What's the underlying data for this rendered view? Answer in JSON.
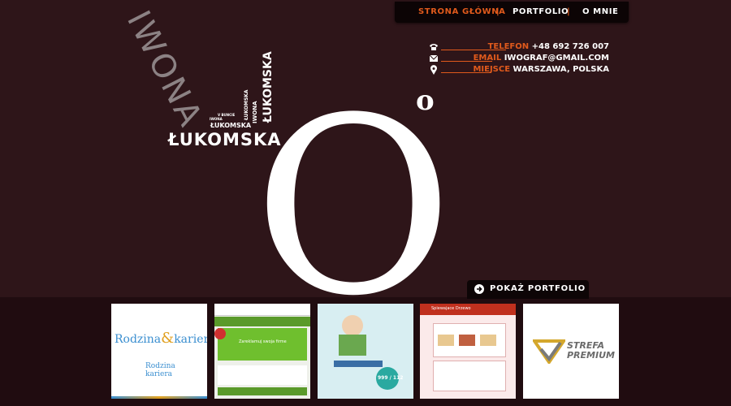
{
  "nav": {
    "items": [
      {
        "label": "STRONA GŁÓWNA",
        "active": true
      },
      {
        "label": "PORTFOLIO",
        "active": false
      },
      {
        "label": "O MNIE",
        "active": false
      }
    ],
    "separator": "|"
  },
  "contact": {
    "phone": {
      "key": "TELEFON",
      "value": "+48 692 726 007",
      "icon": "phone-icon"
    },
    "email": {
      "key": "EMAIL",
      "value": "IWOGRAF@GMAIL.COM",
      "icon": "envelope-icon"
    },
    "place": {
      "key": "MIEJSCE",
      "value": "WARSZAWA, POLSKA",
      "icon": "location-pin-icon"
    }
  },
  "logo": {
    "big_letter": "O",
    "degree": "o",
    "name_large": "ŁUKOMSKA",
    "name_diag": "IWONA",
    "name_vert": "ŁUKOMSKA",
    "small_words": [
      "ŁUKOMSKA",
      "IWONA",
      "ŁUKOMSKA",
      "IWONA",
      "V BUNCIE"
    ]
  },
  "cta": {
    "label": "POKAŻ PORTFOLIO",
    "icon": "arrow-right-icon"
  },
  "thumbs": [
    {
      "title": "Rodzina",
      "amp": "&",
      "title2": "kariera",
      "sub1": "Rodzina",
      "sub2": "kariera"
    },
    {
      "title": "Zareklamuj swoja firme"
    },
    {
      "title": "999 / 112"
    },
    {
      "title": "Spiewajace Drzewo"
    },
    {
      "title": "STREFA",
      "title2": "PREMIUM"
    }
  ],
  "colors": {
    "accent": "#e05a1c",
    "bg": "#2e1519",
    "panel": "#0c0405"
  }
}
